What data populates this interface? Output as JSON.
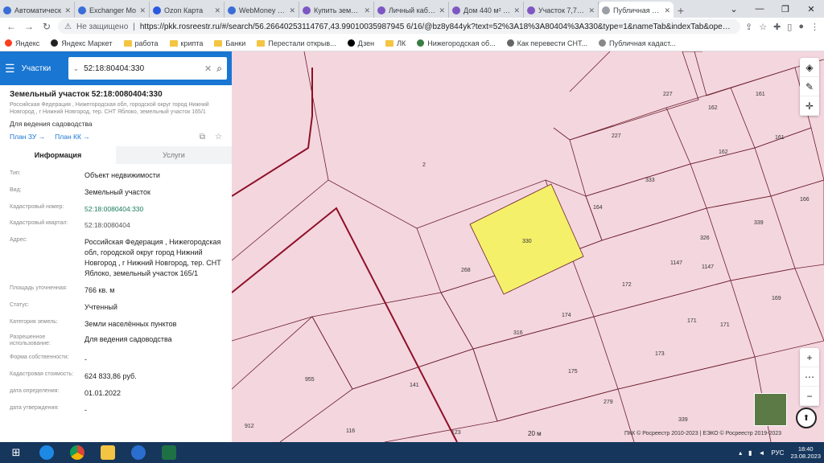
{
  "browser": {
    "tabs": [
      {
        "title": "Автоматическ",
        "favcolor": "#3b6dd8"
      },
      {
        "title": "Exchanger Mo",
        "favcolor": "#3b6dd8"
      },
      {
        "title": "Ozon Карта",
        "favcolor": "#2b59e0"
      },
      {
        "title": "WebMoney Кел",
        "favcolor": "#3b6dd8"
      },
      {
        "title": "Купить земель",
        "favcolor": "#7e57c2"
      },
      {
        "title": "Личный кабин",
        "favcolor": "#7e57c2"
      },
      {
        "title": "Дом 440 м² на",
        "favcolor": "#7e57c2"
      },
      {
        "title": "Участок 7,7 сот",
        "favcolor": "#7e57c2"
      },
      {
        "title": "Публичная кад",
        "favcolor": "#9aa0a6",
        "active": true
      }
    ],
    "security_label": "Не защищено",
    "url": "https://pkk.rosreestr.ru/#/search/56.26640253114767,43.99010035987945 6/16/@bz8y844yk?text=52%3A18%3A80404%3A330&type=1&nameTab&indexTab&opened=52%3A18%3A8..."
  },
  "bookmarks": [
    {
      "label": "Яндекс",
      "icon": "yandex-icon"
    },
    {
      "label": "Яндекс Маркет",
      "icon": "market-icon"
    },
    {
      "label": "работа",
      "icon": "folder-icon"
    },
    {
      "label": "крипта",
      "icon": "folder-icon"
    },
    {
      "label": "Банки",
      "icon": "folder-icon"
    },
    {
      "label": "Перестали открыв...",
      "icon": "folder-icon"
    },
    {
      "label": "Дзен",
      "icon": "dzen-icon"
    },
    {
      "label": "ЛК",
      "icon": "folder-icon"
    },
    {
      "label": "Нижегородская об...",
      "icon": "globe-icon"
    },
    {
      "label": "Как перевести СНТ...",
      "icon": "globe-icon"
    },
    {
      "label": "Публичная кадаст...",
      "icon": "globe-icon"
    }
  ],
  "search": {
    "type_label": "Участки",
    "query": "52:18:80404:330"
  },
  "object": {
    "title": "Земельный участок 52:18:0080404:330",
    "address_small": "Российская Федерация , Нижегородская обл, городской округ город Нижний Новгород , г Нижний Новгород, тер. СНТ Яблоко, земельный участок 165/1",
    "purpose": "Для ведения садоводства",
    "plan_zu": "План ЗУ →",
    "plan_kk": "План КК →"
  },
  "tabs": {
    "info": "Информация",
    "services": "Услуги"
  },
  "attributes": [
    {
      "key": "Тип:",
      "value": "Объект недвижимости"
    },
    {
      "key": "Вид:",
      "value": "Земельный участок"
    },
    {
      "key": "Кадастровый номер:",
      "value": "52:18:0080404:330"
    },
    {
      "key": "Кадастровый квартал:",
      "value": "52:18:0080404"
    },
    {
      "key": "Адрес:",
      "value": "Российская Федерация , Нижегородская обл, городской округ город Нижний Новгород , г Нижний Новгород, тер. СНТ Яблоко, земельный участок 165/1"
    },
    {
      "key": "Площадь уточненная:",
      "value": "766 кв. м"
    },
    {
      "key": "Статус:",
      "value": "Учтенный"
    },
    {
      "key": "Категория земель:",
      "value": "Земли населённых пунктов"
    },
    {
      "key": "Разрешенное использование:",
      "value": "Для ведения садоводства"
    },
    {
      "key": "Форма собственности:",
      "value": "-"
    },
    {
      "key": "Кадастровая стоимость:",
      "value": "624 833,86 руб."
    },
    {
      "key": "дата определения:",
      "value": "01.01.2022"
    },
    {
      "key": "дата утверждения:",
      "value": "-"
    }
  ],
  "map": {
    "parcel_labels": [
      "227",
      "161",
      "162",
      "227",
      "162",
      "161",
      "2",
      "333",
      "164",
      "330",
      "339",
      "166",
      "268",
      "326",
      "1147",
      "1147",
      "172",
      "169",
      "174",
      "171",
      "316",
      "171",
      "173",
      "955",
      "141",
      "175",
      "279",
      "912",
      "116",
      "123",
      "339"
    ],
    "scale": "20 м",
    "attribution": "ПКК © Росреестр 2010-2023 | ЕЭКО © Росреестр 2019-2023",
    "colors": {
      "bg": "#f4d6df",
      "selected": "#f5f06a",
      "line": "#6b1f2b",
      "boundary": "#8e1027"
    }
  },
  "taskbar": {
    "lang": "РУС",
    "time": "18:40",
    "date": "23.08.2023"
  }
}
